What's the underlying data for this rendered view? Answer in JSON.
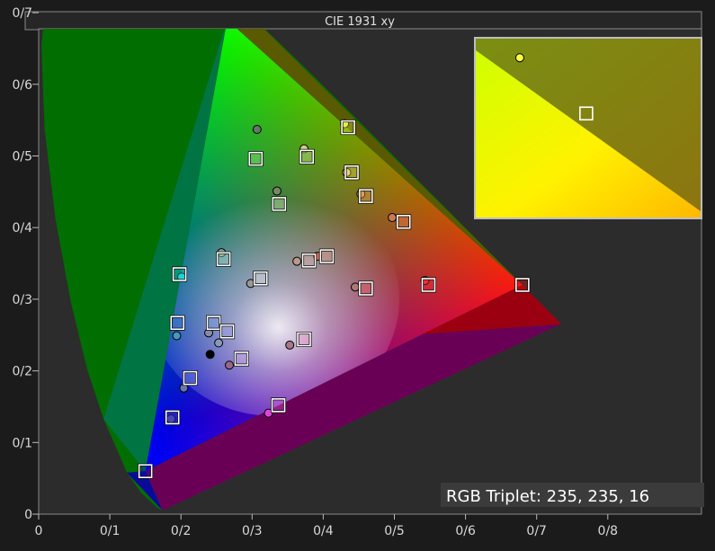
{
  "window": {
    "title": "CIE 1931 xy"
  },
  "readout": {
    "label": "RGB Triplet: 235, 235, 16"
  },
  "colors": {
    "frame": "#1b1b1b",
    "plot_bg": "#2c2c2c",
    "border": "#8a8a8a",
    "axis_text": "#d8d8d8"
  },
  "chart_data": {
    "type": "scatter",
    "title": "CIE 1931 xy",
    "xlim": [
      0,
      0.85
    ],
    "ylim": [
      0,
      0.85
    ],
    "x_ticks": [
      0,
      0.1,
      0.2,
      0.3,
      0.4,
      0.5,
      0.6,
      0.7,
      0.8
    ],
    "y_ticks": [
      0,
      0.1,
      0.2,
      0.3,
      0.4,
      0.5,
      0.6,
      0.7,
      0.8
    ],
    "x_tick_labels": [
      "0",
      "0/1",
      "0/2",
      "0/3",
      "0/4",
      "0/5",
      "0/6",
      "0/7",
      "0/8"
    ],
    "y_tick_labels": [
      "0",
      "0/1",
      "0/2",
      "0/3",
      "0/4",
      "0/5",
      "0/6",
      "0/7",
      "0/8"
    ],
    "gamut_triangle": [
      [
        0.265,
        0.69
      ],
      [
        0.68,
        0.32
      ],
      [
        0.15,
        0.06
      ]
    ],
    "series": [
      {
        "marker": "square",
        "points": [
          [
            0.265,
            0.69
          ],
          [
            0.68,
            0.32
          ],
          [
            0.15,
            0.06
          ],
          [
            0.312,
            0.329
          ],
          [
            0.198,
            0.335
          ],
          [
            0.195,
            0.267
          ],
          [
            0.246,
            0.267
          ],
          [
            0.265,
            0.255
          ],
          [
            0.26,
            0.356
          ],
          [
            0.305,
            0.496
          ],
          [
            0.377,
            0.499
          ],
          [
            0.338,
            0.433
          ],
          [
            0.435,
            0.54
          ],
          [
            0.44,
            0.477
          ],
          [
            0.46,
            0.444
          ],
          [
            0.513,
            0.408
          ],
          [
            0.548,
            0.32
          ],
          [
            0.405,
            0.36
          ],
          [
            0.38,
            0.354
          ],
          [
            0.46,
            0.315
          ],
          [
            0.373,
            0.244
          ],
          [
            0.285,
            0.217
          ],
          [
            0.213,
            0.19
          ],
          [
            0.188,
            0.135
          ],
          [
            0.337,
            0.152
          ]
        ],
        "point_colors": [
          "#22cc22",
          "#ee1111",
          "#1111cc",
          "#ffffff",
          "#22dddd",
          "#4488dd",
          "#88aaee",
          "#aaaaee",
          "#ccffee",
          "#bbff99",
          "#eeffaa",
          "#eeffcc",
          "#ddee44",
          "#ffe066",
          "#ffaa66",
          "#ff8866",
          "#ff3344",
          "#ffbbaa",
          "#ffcccc",
          "#ff6666",
          "#ff99cc",
          "#ddbbee",
          "#7788ee",
          "#5555dd",
          "#ee66ee"
        ]
      },
      {
        "marker": "circle",
        "points": [
          [
            0.267,
            0.686
          ],
          [
            0.201,
            0.331
          ],
          [
            0.307,
            0.537
          ],
          [
            0.373,
            0.51
          ],
          [
            0.43,
            0.545
          ],
          [
            0.335,
            0.451
          ],
          [
            0.257,
            0.365
          ],
          [
            0.298,
            0.322
          ],
          [
            0.363,
            0.353
          ],
          [
            0.392,
            0.36
          ],
          [
            0.433,
            0.477
          ],
          [
            0.453,
            0.447
          ],
          [
            0.497,
            0.414
          ],
          [
            0.543,
            0.326
          ],
          [
            0.445,
            0.317
          ],
          [
            0.194,
            0.249
          ],
          [
            0.239,
            0.253
          ],
          [
            0.253,
            0.239
          ],
          [
            0.241,
            0.223
          ],
          [
            0.268,
            0.208
          ],
          [
            0.353,
            0.236
          ],
          [
            0.204,
            0.176
          ],
          [
            0.186,
            0.133
          ],
          [
            0.323,
            0.141
          ]
        ],
        "point_colors": [
          "#22bb22",
          "#22cccc",
          "#667766",
          "#cccc88",
          "#eeee55",
          "#778866",
          "#88aa88",
          "#999999",
          "#bb9988",
          "#cc6644",
          "#ddcc88",
          "#cc9955",
          "#cc7755",
          "#dd3333",
          "#aa7777",
          "#4499bb",
          "#8888aa",
          "#8899bb",
          "#000000",
          "#996688",
          "#aa7788",
          "#6677aa",
          "#4444aa",
          "#dd44dd"
        ]
      }
    ]
  },
  "inset": {
    "x_range": [
      0.43,
      0.5
    ],
    "y_range": [
      0.455,
      0.515
    ],
    "circle": [
      0.4437,
      0.5086
    ],
    "square": [
      0.4644,
      0.4899
    ]
  }
}
